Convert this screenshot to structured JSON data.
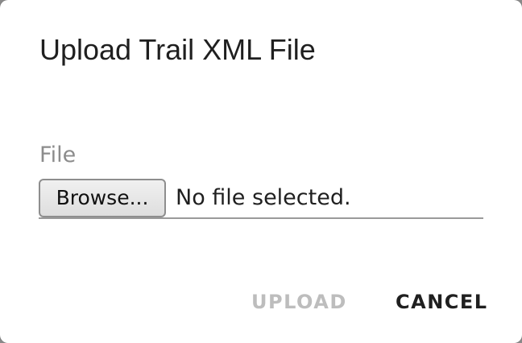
{
  "dialog": {
    "title": "Upload Trail XML File",
    "field": {
      "label": "File",
      "browse_label": "Browse...",
      "status_text": "No file selected."
    },
    "actions": {
      "upload_label": "UPLOAD",
      "upload_enabled": false,
      "cancel_label": "CANCEL"
    }
  },
  "colors": {
    "title_text": "#1f1f1f",
    "label_text": "#8c8c8c",
    "disabled_action": "#bdbdbd",
    "primary_action": "#1f1f1f",
    "field_underline": "#9a9a9a"
  }
}
